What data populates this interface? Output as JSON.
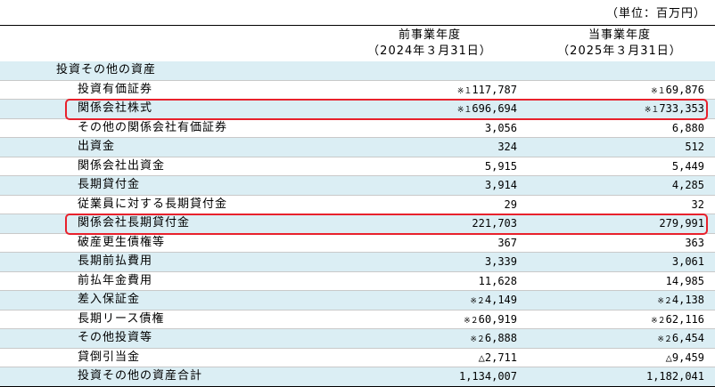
{
  "unit_label": "（単位：百万円）",
  "columns": [
    {
      "title": "前事業年度",
      "date": "（2024年３月31日）"
    },
    {
      "title": "当事業年度",
      "date": "（2025年３月31日）"
    }
  ],
  "section_label": "投資その他の資産",
  "rows": [
    {
      "label": "投資有価証券",
      "v1_note": "※１",
      "v1": "117,787",
      "v2_note": "※１",
      "v2": "69,876"
    },
    {
      "label": "関係会社株式",
      "v1_note": "※１",
      "v1": "696,694",
      "v2_note": "※１",
      "v2": "733,353",
      "highlighted": true
    },
    {
      "label": "その他の関係会社有価証券",
      "v1_note": "",
      "v1": "3,056",
      "v2_note": "",
      "v2": "6,880"
    },
    {
      "label": "出資金",
      "v1_note": "",
      "v1": "324",
      "v2_note": "",
      "v2": "512"
    },
    {
      "label": "関係会社出資金",
      "v1_note": "",
      "v1": "5,915",
      "v2_note": "",
      "v2": "5,449"
    },
    {
      "label": "長期貸付金",
      "v1_note": "",
      "v1": "3,914",
      "v2_note": "",
      "v2": "4,285"
    },
    {
      "label": "従業員に対する長期貸付金",
      "v1_note": "",
      "v1": "29",
      "v2_note": "",
      "v2": "32"
    },
    {
      "label": "関係会社長期貸付金",
      "v1_note": "",
      "v1": "221,703",
      "v2_note": "",
      "v2": "279,991",
      "highlighted": true
    },
    {
      "label": "破産更生債権等",
      "v1_note": "",
      "v1": "367",
      "v2_note": "",
      "v2": "363"
    },
    {
      "label": "長期前払費用",
      "v1_note": "",
      "v1": "3,339",
      "v2_note": "",
      "v2": "3,061"
    },
    {
      "label": "前払年金費用",
      "v1_note": "",
      "v1": "11,628",
      "v2_note": "",
      "v2": "14,985"
    },
    {
      "label": "差入保証金",
      "v1_note": "※２",
      "v1": "4,149",
      "v2_note": "※２",
      "v2": "4,138"
    },
    {
      "label": "長期リース債権",
      "v1_note": "※２",
      "v1": "60,919",
      "v2_note": "※２",
      "v2": "62,116"
    },
    {
      "label": "その他投資等",
      "v1_note": "※２",
      "v1": "6,888",
      "v2_note": "※２",
      "v2": "6,454"
    },
    {
      "label": "貸倒引当金",
      "v1_note": "",
      "v1": "△2,711",
      "v2_note": "",
      "v2": "△9,459"
    }
  ],
  "total": {
    "label": "投資その他の資産合計",
    "v1": "1,134,007",
    "v2": "1,182,041"
  }
}
